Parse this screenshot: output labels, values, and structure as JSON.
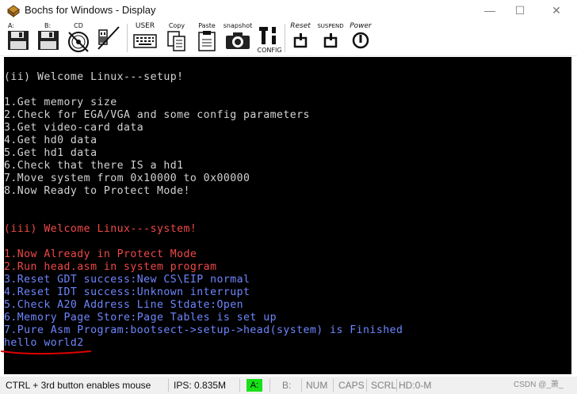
{
  "window": {
    "title": "Bochs for Windows - Display",
    "minimize_glyph": "—",
    "maximize_glyph": "☐",
    "close_glyph": "✕"
  },
  "toolbar": {
    "floppy_a_label": "A:",
    "floppy_b_label": "B:",
    "cdrom_label": "CD",
    "user_label": "USER",
    "copy_label": "Copy",
    "paste_label": "Paste",
    "snapshot_label": "snapshot",
    "config_label": "CONFIG",
    "reset_label": "Reset",
    "suspend_label": "SUSPEND",
    "power_label": "Power"
  },
  "console": {
    "setup_header": "(ii) Welcome Linux---setup!",
    "setup_lines": [
      "1.Get memory size",
      "2.Check for EGA/VGA and some config parameters",
      "3.Get video-card data",
      "4.Get hd0 data",
      "5.Get hd1 data",
      "6.Check that there IS a hd1",
      "7.Move system from 0x10000 to 0x00000",
      "8.Now Ready to Protect Mode!"
    ],
    "system_header": "(iii) Welcome Linux---system!",
    "system_lines_red": [
      "1.Now Already in Protect Mode",
      "2.Run head.asm in system program"
    ],
    "system_lines_blue": [
      "3.Reset GDT success:New CS\\EIP normal",
      "4.Reset IDT success:Unknown interrupt",
      "5.Check A20 Address Line Stdate:Open",
      "6.Memory Page Store:Page Tables is set up",
      "7.Pure Asm Program:bootsect->setup->head(system) is Finished"
    ],
    "last_line": "hello world2"
  },
  "statusbar": {
    "mouse_hint": "CTRL + 3rd button enables mouse",
    "ips": "IPS: 0.835M",
    "a_indicator": "A:",
    "b_indicator": "B:",
    "num": "NUM",
    "caps": "CAPS",
    "scrl": "SCRL",
    "hd": "HD:0-M"
  },
  "watermark": "CSDN @_萧_",
  "colors": {
    "console_bg": "#000000",
    "text_grey": "#d3d3d3",
    "text_red": "#f04848",
    "text_blue": "#6e86ff",
    "annotation_red": "#e00000",
    "indicator_green": "#18e018"
  }
}
